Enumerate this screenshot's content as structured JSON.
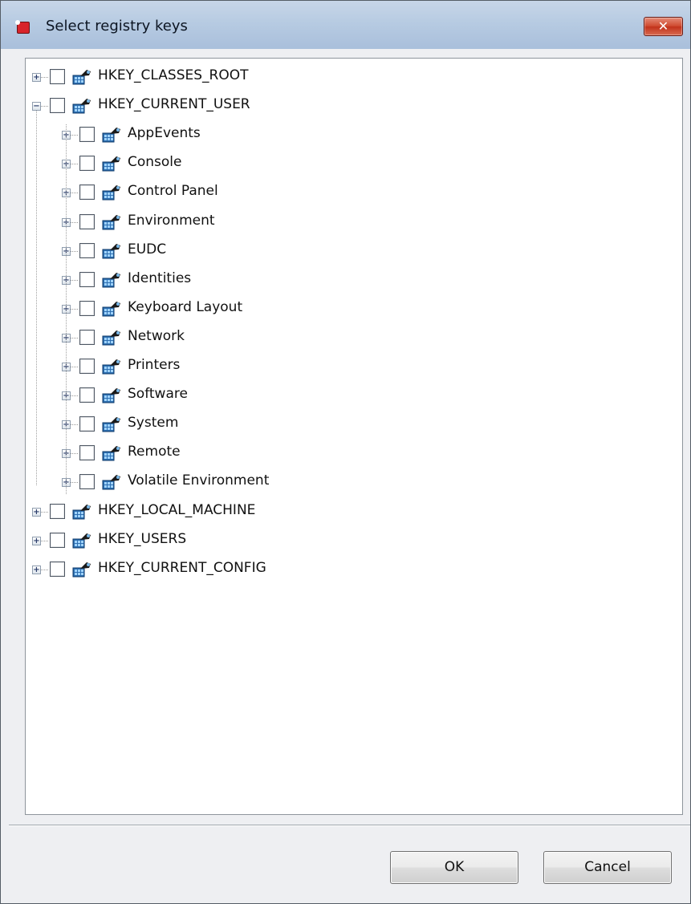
{
  "window": {
    "title": "Select registry keys",
    "close_glyph": "✕"
  },
  "icons": {
    "app": "registry-app-icon",
    "key": "registry-key-icon",
    "expand": "+",
    "collapse": "−"
  },
  "tree": {
    "roots": [
      {
        "label": "HKEY_CLASSES_ROOT",
        "expanded": false,
        "checked": false
      },
      {
        "label": "HKEY_CURRENT_USER",
        "expanded": true,
        "checked": false,
        "children": [
          {
            "label": "AppEvents",
            "checked": false
          },
          {
            "label": "Console",
            "checked": false
          },
          {
            "label": "Control Panel",
            "checked": false
          },
          {
            "label": "Environment",
            "checked": false
          },
          {
            "label": "EUDC",
            "checked": false
          },
          {
            "label": "Identities",
            "checked": false
          },
          {
            "label": "Keyboard Layout",
            "checked": false
          },
          {
            "label": "Network",
            "checked": false
          },
          {
            "label": "Printers",
            "checked": false
          },
          {
            "label": "Software",
            "checked": false
          },
          {
            "label": "System",
            "checked": false
          },
          {
            "label": "Remote",
            "checked": false
          },
          {
            "label": "Volatile Environment",
            "checked": false
          }
        ]
      },
      {
        "label": "HKEY_LOCAL_MACHINE",
        "expanded": false,
        "checked": false
      },
      {
        "label": "HKEY_USERS",
        "expanded": false,
        "checked": false
      },
      {
        "label": "HKEY_CURRENT_CONFIG",
        "expanded": false,
        "checked": false
      }
    ]
  },
  "buttons": {
    "ok": "OK",
    "cancel": "Cancel"
  }
}
